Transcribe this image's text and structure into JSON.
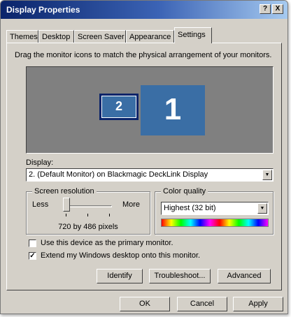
{
  "window": {
    "title": "Display Properties",
    "help_label": "?",
    "close_label": "X"
  },
  "tabs": [
    {
      "label": "Themes"
    },
    {
      "label": "Desktop"
    },
    {
      "label": "Screen Saver"
    },
    {
      "label": "Appearance"
    },
    {
      "label": "Settings"
    }
  ],
  "settings": {
    "instruction": "Drag the monitor icons to match the physical arrangement of your monitors.",
    "monitors": [
      {
        "label": "2"
      },
      {
        "label": "1"
      }
    ],
    "display_label": "Display:",
    "display_value": "2. (Default Monitor) on Blackmagic DeckLink Display",
    "screen_resolution": {
      "title": "Screen resolution",
      "less_label": "Less",
      "more_label": "More",
      "value_text": "720 by 486 pixels"
    },
    "color_quality": {
      "title": "Color quality",
      "value": "Highest (32 bit)"
    },
    "checkboxes": [
      {
        "label": "Use this device as the primary monitor.",
        "checked": false,
        "mark": ""
      },
      {
        "label": "Extend my Windows desktop onto this monitor.",
        "checked": true,
        "mark": "✓"
      }
    ],
    "buttons": {
      "identify": "Identify",
      "troubleshoot": "Troubleshoot...",
      "advanced": "Advanced"
    }
  },
  "dialog_buttons": {
    "ok": "OK",
    "cancel": "Cancel",
    "apply": "Apply"
  },
  "colors": {
    "monitor_blue": "#3a6ea5",
    "monitor_area": "#808080",
    "face": "#d4d0c8"
  }
}
